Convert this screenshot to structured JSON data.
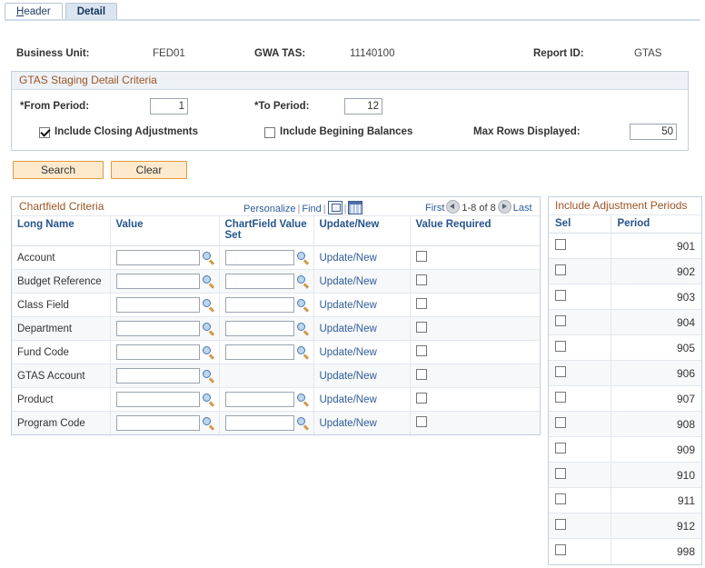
{
  "tabs": [
    {
      "label": "Header",
      "accesskey": "H",
      "active": false
    },
    {
      "label": "Detail",
      "accesskey": "",
      "active": true
    }
  ],
  "header_fields": [
    {
      "label": "Business Unit:",
      "value": "FED01"
    },
    {
      "label": "GWA TAS:",
      "value": "11140100"
    },
    {
      "label": "Report ID:",
      "value": "GTAS"
    }
  ],
  "criteria": {
    "title": "GTAS Staging Detail Criteria",
    "from_period_label": "*From Period:",
    "from_period_value": "1",
    "to_period_label": "*To Period:",
    "to_period_value": "12",
    "include_closing_label": "Include Closing Adjustments",
    "include_closing_checked": true,
    "include_begining_label": "Include Begining Balances",
    "include_begining_checked": false,
    "max_rows_label": "Max Rows Displayed:",
    "max_rows_value": "50"
  },
  "buttons": {
    "search": "Search",
    "clear": "Clear"
  },
  "grid": {
    "title": "Chartfield Criteria",
    "tools": {
      "personalize": "Personalize",
      "find": "Find",
      "sep": "|",
      "expand_icon": "expand-icon",
      "grid_icon": "download-grid-icon"
    },
    "nav": {
      "first": "First",
      "range": "1-8 of 8",
      "last": "Last",
      "prev_icon": "prev-arrow-icon",
      "next_icon": "next-arrow-icon"
    },
    "columns": [
      "Long Name",
      "Value",
      "ChartField Value Set",
      "Update/New",
      "Value Required"
    ],
    "update_link_label": "Update/New",
    "rows": [
      {
        "long_name": "Account",
        "value": "",
        "value_set": "",
        "has_value_set": true,
        "update_new": "Update/New",
        "value_required": false
      },
      {
        "long_name": "Budget Reference",
        "value": "",
        "value_set": "",
        "has_value_set": true,
        "update_new": "Update/New",
        "value_required": false
      },
      {
        "long_name": "Class Field",
        "value": "",
        "value_set": "",
        "has_value_set": true,
        "update_new": "Update/New",
        "value_required": false
      },
      {
        "long_name": "Department",
        "value": "",
        "value_set": "",
        "has_value_set": true,
        "update_new": "Update/New",
        "value_required": false
      },
      {
        "long_name": "Fund Code",
        "value": "",
        "value_set": "",
        "has_value_set": true,
        "update_new": "Update/New",
        "value_required": false
      },
      {
        "long_name": "GTAS Account",
        "value": "",
        "value_set": "",
        "has_value_set": false,
        "update_new": "Update/New",
        "value_required": false
      },
      {
        "long_name": "Product",
        "value": "",
        "value_set": "",
        "has_value_set": true,
        "update_new": "Update/New",
        "value_required": false
      },
      {
        "long_name": "Program Code",
        "value": "",
        "value_set": "",
        "has_value_set": true,
        "update_new": "Update/New",
        "value_required": false
      }
    ]
  },
  "adjustment_periods": {
    "title": "Include Adjustment Periods",
    "columns": [
      "Sel",
      "Period"
    ],
    "rows": [
      {
        "sel": false,
        "period": "901"
      },
      {
        "sel": false,
        "period": "902"
      },
      {
        "sel": false,
        "period": "903"
      },
      {
        "sel": false,
        "period": "904"
      },
      {
        "sel": false,
        "period": "905"
      },
      {
        "sel": false,
        "period": "906"
      },
      {
        "sel": false,
        "period": "907"
      },
      {
        "sel": false,
        "period": "908"
      },
      {
        "sel": false,
        "period": "909"
      },
      {
        "sel": false,
        "period": "910"
      },
      {
        "sel": false,
        "period": "911"
      },
      {
        "sel": false,
        "period": "912"
      },
      {
        "sel": false,
        "period": "998"
      }
    ]
  },
  "colors": {
    "section_title": "#9a5525",
    "link": "#2f5c99",
    "column_header": "#27548c",
    "button_face": "#fdeacd",
    "button_border": "#e09a3e",
    "groupbox_header": "#eef2f7",
    "tab_active": "#dbe5f1"
  }
}
